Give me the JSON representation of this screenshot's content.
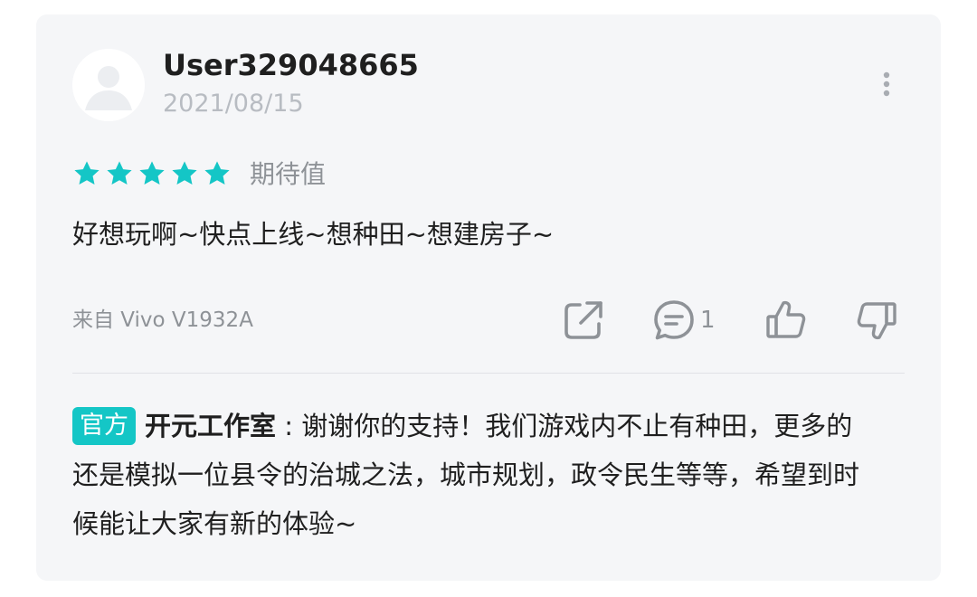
{
  "review": {
    "username": "User329048665",
    "date": "2021/08/15",
    "stars": 5,
    "rating_label": "期待值",
    "content": "好想玩啊~快点上线~想种田~想建房子~",
    "device": "来自 Vivo V1932A",
    "comment_count": "1"
  },
  "reply": {
    "badge": "官方",
    "author": "开元工作室",
    "separator": " : ",
    "text": "谢谢你的支持！我们游戏内不止有种田，更多的还是模拟一位县令的治城之法，城市规划，政令民生等等，希望到时候能让大家有新的体验~"
  },
  "colors": {
    "accent": "#14c6c6",
    "card_bg": "#f5f6f8",
    "icon_gray": "#8e9297",
    "text_dark": "#1f1f1f"
  },
  "icons": [
    "avatar-placeholder",
    "more-vertical-icon",
    "star-icon",
    "share-icon",
    "comment-icon",
    "thumbs-up-icon",
    "thumbs-down-icon"
  ]
}
